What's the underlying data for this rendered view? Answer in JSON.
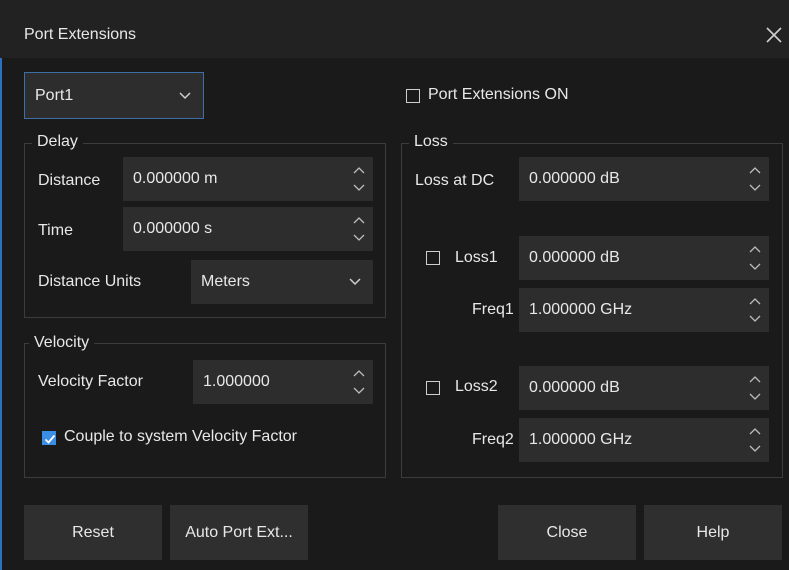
{
  "dialog": {
    "title": "Port Extensions"
  },
  "port": {
    "selected": "Port1"
  },
  "port_ext_on": {
    "label": "Port Extensions ON",
    "checked": false
  },
  "delay": {
    "legend": "Delay",
    "distance_label": "Distance",
    "distance_value": "0.000000 m",
    "time_label": "Time",
    "time_value": "0.000000 s",
    "units_label": "Distance Units",
    "units_value": "Meters"
  },
  "velocity": {
    "legend": "Velocity",
    "factor_label": "Velocity Factor",
    "factor_value": "1.000000",
    "couple_label": "Couple to system Velocity Factor",
    "couple_checked": true
  },
  "loss": {
    "legend": "Loss",
    "dc_label": "Loss at DC",
    "dc_value": "0.000000 dB",
    "loss1_label": "Loss1",
    "loss1_checked": false,
    "loss1_value": "0.000000 dB",
    "freq1_label": "Freq1",
    "freq1_value": "1.000000 GHz",
    "loss2_label": "Loss2",
    "loss2_checked": false,
    "loss2_value": "0.000000 dB",
    "freq2_label": "Freq2",
    "freq2_value": "1.000000 GHz"
  },
  "buttons": {
    "reset": "Reset",
    "auto": "Auto Port Ext...",
    "close": "Close",
    "help": "Help"
  },
  "colors": {
    "accent": "#3a8ee6",
    "border_focus": "#3d6ea8"
  }
}
